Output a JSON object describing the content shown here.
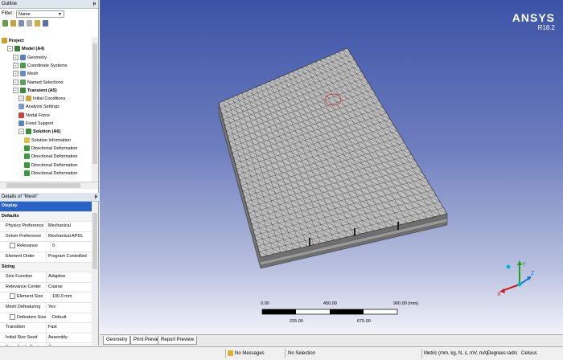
{
  "outline": {
    "title": "Outline",
    "pin": "ᵽ",
    "filter_label": "Filter:",
    "filter_value": "Name",
    "tree": [
      {
        "label": "Project",
        "bold": true,
        "depth": 0,
        "icon": "#c9a227",
        "exp": ""
      },
      {
        "label": "Model (A4)",
        "bold": true,
        "depth": 1,
        "icon": "#3c7d3c",
        "exp": "−"
      },
      {
        "label": "Geometry",
        "bold": false,
        "depth": 2,
        "icon": "#5a7fc4",
        "exp": "+"
      },
      {
        "label": "Coordinate Systems",
        "bold": false,
        "depth": 2,
        "icon": "#4c9a4c",
        "exp": "+"
      },
      {
        "label": "Mesh",
        "bold": false,
        "depth": 2,
        "icon": "#6a8ad0",
        "exp": "+"
      },
      {
        "label": "Named Selections",
        "bold": false,
        "depth": 2,
        "icon": "#5aa05a",
        "exp": "+"
      },
      {
        "label": "Transient (A5)",
        "bold": true,
        "depth": 2,
        "icon": "#3c8a3c",
        "exp": "−"
      },
      {
        "label": "Initial Conditions",
        "bold": false,
        "depth": 3,
        "icon": "#d2a33a",
        "exp": "+"
      },
      {
        "label": "Analysis Settings",
        "bold": false,
        "depth": 3,
        "icon": "#7a9ad4",
        "exp": ""
      },
      {
        "label": "Nodal Force",
        "bold": false,
        "depth": 3,
        "icon": "#c94040",
        "exp": ""
      },
      {
        "label": "Fixed Support",
        "bold": false,
        "depth": 3,
        "icon": "#5a7fc4",
        "exp": ""
      },
      {
        "label": "Solution (A6)",
        "bold": true,
        "depth": 3,
        "icon": "#3c8a3c",
        "exp": "−"
      },
      {
        "label": "Solution Information",
        "bold": false,
        "depth": 4,
        "icon": "#e0c040",
        "exp": ""
      },
      {
        "label": "Directional Deformation",
        "bold": false,
        "depth": 4,
        "icon": "#3a9a3a",
        "exp": ""
      },
      {
        "label": "Directional Deformation",
        "bold": false,
        "depth": 4,
        "icon": "#3a9a3a",
        "exp": ""
      },
      {
        "label": "Directional Deformation",
        "bold": false,
        "depth": 4,
        "icon": "#3a9a3a",
        "exp": ""
      },
      {
        "label": "Directional Deformation",
        "bold": false,
        "depth": 4,
        "icon": "#3a9a3a",
        "exp": ""
      }
    ]
  },
  "details": {
    "title": "Details of \"Mesh\"",
    "rows": [
      {
        "type": "selected",
        "key": "Display",
        "value": ""
      },
      {
        "type": "section",
        "key": "Defaults",
        "value": ""
      },
      {
        "type": "row",
        "key": "Physics Preference",
        "value": "Mechanical"
      },
      {
        "type": "row",
        "key": "Solver Preference",
        "value": "Mechanical APDL"
      },
      {
        "type": "check",
        "key": "Relevance",
        "value": "0"
      },
      {
        "type": "row",
        "key": "Element Order",
        "value": "Program Controlled"
      },
      {
        "type": "section",
        "key": "Sizing",
        "value": ""
      },
      {
        "type": "row",
        "key": "Size Function",
        "value": "Adaptive"
      },
      {
        "type": "row",
        "key": "Relevance Center",
        "value": "Coarse"
      },
      {
        "type": "check",
        "key": "Element Size",
        "value": "100.0 mm"
      },
      {
        "type": "row",
        "key": "Mesh Defeaturing",
        "value": "Yes"
      },
      {
        "type": "check",
        "key": "Defeature Size",
        "value": "Default"
      },
      {
        "type": "row",
        "key": "Transition",
        "value": "Fast"
      },
      {
        "type": "row",
        "key": "Initial Size Seed",
        "value": "Assembly"
      },
      {
        "type": "row",
        "key": "Span Angle Center",
        "value": "Coarse"
      }
    ]
  },
  "viewport": {
    "logo_brand": "ANSYS",
    "logo_version": "R18.2",
    "scale": {
      "top_labels": [
        "0.00",
        "450.00",
        "900.00 (mm)"
      ],
      "bottom_labels": [
        "225.00",
        "675.00"
      ]
    },
    "axes": {
      "x": "X",
      "y": "Y",
      "z": "Z"
    }
  },
  "tabs": [
    "Geometry",
    "Print Preview",
    "Report Preview"
  ],
  "status": {
    "messages": "No Messages",
    "selection": "No Selection",
    "units": "Metric (mm, kg, N, s, mV, mA)",
    "angle": "Degrees",
    "rate": "rad/s",
    "temp": "Celsius"
  }
}
